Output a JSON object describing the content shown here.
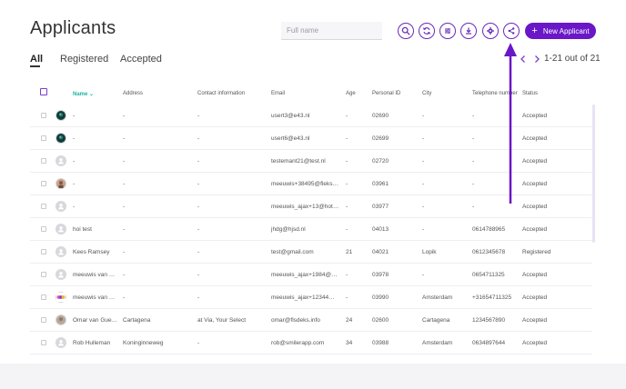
{
  "page": {
    "title": "Applicants"
  },
  "search": {
    "placeholder": "Full name"
  },
  "toolbar": {
    "icons": [
      "search-icon",
      "refresh-icon",
      "filter-list-icon",
      "download-icon",
      "settings-gear-icon",
      "share-icon"
    ],
    "new_button_label": "New Applicant",
    "accent_color": "#6a17c8"
  },
  "tabs": [
    {
      "label": "All",
      "active": true
    },
    {
      "label": "Registered",
      "active": false
    },
    {
      "label": "Accepted",
      "active": false
    }
  ],
  "pagination": {
    "text": "1-21 out of 21"
  },
  "table": {
    "columns": {
      "name": "Name",
      "address": "Address",
      "contact": "Contact information",
      "email": "Email",
      "age": "Age",
      "personal_id": "Personal ID",
      "city": "City",
      "phone": "Telephone number",
      "status": "Status"
    },
    "rows": [
      {
        "avatar": "photo-dark",
        "name": "-",
        "address": "-",
        "contact": "-",
        "email": "usert3@e43.nl",
        "age": "-",
        "personal_id": "02690",
        "city": "-",
        "phone": "-",
        "status": "Accepted"
      },
      {
        "avatar": "photo-dark",
        "name": "-",
        "address": "-",
        "contact": "-",
        "email": "usert6@e43.nl",
        "age": "-",
        "personal_id": "02699",
        "city": "-",
        "phone": "-",
        "status": "Accepted"
      },
      {
        "avatar": "default",
        "name": "-",
        "address": "-",
        "contact": "-",
        "email": "testemant21@test.nl",
        "age": "-",
        "personal_id": "02720",
        "city": "-",
        "phone": "-",
        "status": "Accepted"
      },
      {
        "avatar": "photo-face",
        "name": "-",
        "address": "-",
        "contact": "-",
        "email": "meeuwis+38495@fleks…",
        "age": "-",
        "personal_id": "03961",
        "city": "-",
        "phone": "-",
        "status": "Accepted"
      },
      {
        "avatar": "default",
        "name": "-",
        "address": "-",
        "contact": "-",
        "email": "meeuwis_ajax+13@hot…",
        "age": "-",
        "personal_id": "03977",
        "city": "-",
        "phone": "-",
        "status": "Accepted"
      },
      {
        "avatar": "default",
        "name": "hoi test",
        "address": "-",
        "contact": "-",
        "email": "jhdg@hjsd.nl",
        "age": "-",
        "personal_id": "04013",
        "city": "-",
        "phone": "0614788965",
        "status": "Accepted"
      },
      {
        "avatar": "default",
        "name": "Kees Ramsey",
        "address": "-",
        "contact": "-",
        "email": "test@gmail.com",
        "age": "21",
        "personal_id": "04021",
        "city": "Lopik",
        "phone": "0612345678",
        "status": "Registered"
      },
      {
        "avatar": "default",
        "name": "meeuwis van …",
        "address": "-",
        "contact": "-",
        "email": "meeuwis_ajax+1984@…",
        "age": "-",
        "personal_id": "03978",
        "city": "-",
        "phone": "0654711325",
        "status": "Accepted"
      },
      {
        "avatar": "photo-colorful",
        "name": "meeuwis van …",
        "address": "-",
        "contact": "-",
        "email": "meeuwis_ajax+12344…",
        "age": "-",
        "personal_id": "03990",
        "city": "Amsterdam",
        "phone": "+31654711325",
        "status": "Accepted"
      },
      {
        "avatar": "photo-light",
        "name": "Omar van Gue…",
        "address": "Cartagena",
        "contact": "at Via, Your Select",
        "email": "omar@flsdeks.info",
        "age": "24",
        "personal_id": "02600",
        "city": "Cartagena",
        "phone": "1234567890",
        "status": "Accepted"
      },
      {
        "avatar": "default",
        "name": "Rob Hulleman",
        "address": "Koninginneweg",
        "contact": "-",
        "email": "rob@smilerapp.com",
        "age": "34",
        "personal_id": "03988",
        "city": "Amsterdam",
        "phone": "0634897644",
        "status": "Accepted"
      }
    ]
  }
}
